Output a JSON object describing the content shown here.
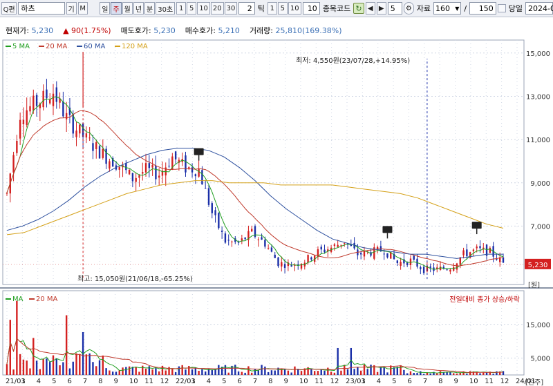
{
  "toolbar": {
    "search_label": "Q편",
    "stock_name": "하츠",
    "mode_btn1": "기",
    "mode_btn2": "M",
    "periods": [
      "일",
      "주",
      "월",
      "년",
      "분",
      "30초"
    ],
    "period_active": "주",
    "intervals": [
      "1",
      "5",
      "10",
      "20",
      "30"
    ],
    "interval_value": "2",
    "tick_label": "틱",
    "tick_intervals": [
      "1",
      "5",
      "10"
    ],
    "tick_value": "10",
    "code_label": "종목코드",
    "stepper_value": "5",
    "data_label": "자료",
    "data_count": "160",
    "separator": "/",
    "data_total": "150",
    "today_label": "당일",
    "date_value": "2024-0"
  },
  "info": {
    "current_label": "현재가:",
    "current_value": "5,230",
    "change": "▲ 90(1.75%)",
    "ask_label": "매도호가:",
    "ask_value": "5,230",
    "bid_label": "매수호가:",
    "bid_value": "5,210",
    "volume_label": "거래량:",
    "volume_value": "25,810(169.38%)"
  },
  "chart_data": {
    "type": "candlestick",
    "legend": [
      {
        "name": "5 MA",
        "color": "#1f9e1f"
      },
      {
        "name": "20 MA",
        "color": "#c0392b"
      },
      {
        "name": "60 MA",
        "color": "#2c4f9e"
      },
      {
        "name": "120 MA",
        "color": "#d4a017"
      }
    ],
    "x_ticks": [
      "21/01",
      "3",
      "4",
      "5",
      "6",
      "7",
      "8",
      "9",
      "10",
      "11",
      "12",
      "22/01",
      "3",
      "4",
      "5",
      "6",
      "7",
      "8",
      "9",
      "10",
      "11",
      "12",
      "23/01",
      "3",
      "4",
      "5",
      "6",
      "7",
      "8",
      "9",
      "10",
      "11",
      "12",
      "24/01"
    ],
    "y_ticks": [
      "15,000",
      "13,000",
      "11,000",
      "9,000",
      "7,000"
    ],
    "ylim": [
      4300,
      15600
    ],
    "y_unit": "[원]",
    "current_price_label": "5,230",
    "current_price": 5230,
    "annotation_high": "최고: 15,050원(21/06/18,-65.25%)",
    "annotation_low": "최저: 4,550원(23/07/28,+14.95%)",
    "high_value": 15050,
    "low_value": 4550,
    "ma60": [
      6800,
      7000,
      7300,
      7700,
      8200,
      8800,
      9300,
      9700,
      10000,
      10300,
      10500,
      10600,
      10600,
      10500,
      10200,
      9700,
      9100,
      8400,
      7800,
      7300,
      6800,
      6400,
      6200,
      6000,
      5900,
      5800,
      5700,
      5700,
      5600,
      5500,
      5600,
      5700,
      5700
    ],
    "ma120": [
      6600,
      6700,
      7000,
      7300,
      7600,
      7900,
      8200,
      8500,
      8700,
      8900,
      9000,
      9100,
      9100,
      9000,
      9000,
      9000,
      8900,
      8900,
      8900,
      8900,
      8800,
      8700,
      8600,
      8500,
      8300,
      8000,
      7700,
      7400,
      7100,
      6900
    ],
    "volume_panel": {
      "legend": [
        {
          "name": "MA",
          "color": "#1f9e1f"
        },
        {
          "name": "20 MA",
          "color": "#c0392b"
        }
      ],
      "caption": "전일대비 종가 상승/하락",
      "y_ticks": [
        "15,000",
        "5,000"
      ],
      "ylim": [
        0,
        25000
      ],
      "y_unit": "[천주]"
    },
    "colors": {
      "up": "#d42020",
      "down": "#1a2fa8",
      "grid": "#cfd6e4"
    }
  }
}
